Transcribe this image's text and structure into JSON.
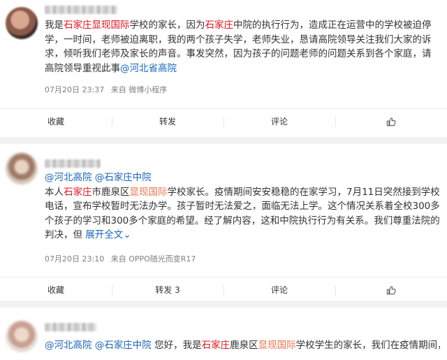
{
  "posts": [
    {
      "segments": [
        {
          "t": "我是",
          "c": ""
        },
        {
          "t": "石家庄",
          "c": "tag"
        },
        {
          "t": "显现国际",
          "c": "tag"
        },
        {
          "t": "学校的家长，因为",
          "c": ""
        },
        {
          "t": "石家庄",
          "c": "tag"
        },
        {
          "t": "中院的执行行为，造成正在运营中的学校被迫停学，一时间，老师被迫离职，我的两个孩子失学，老师失业，恳请高院领导关注我们大家的诉求，倾听我们老师及家长的声音。事发突然，因为孩子的问题老师的问题关系到各个家庭，请高院领导重视此事",
          "c": ""
        },
        {
          "t": "@河北省高院",
          "c": "mention"
        }
      ],
      "time": "07月20日 23:37",
      "source": "来自 微博小程序",
      "actions": {
        "fav": "收藏",
        "repost": "转发",
        "comment": "评论"
      }
    },
    {
      "segments": [
        {
          "t": "@河北高院",
          "c": "mention"
        },
        {
          "t": " ",
          "c": ""
        },
        {
          "t": "@石家庄中院",
          "c": "mention"
        },
        {
          "t": "\n本人",
          "c": ""
        },
        {
          "t": "石家庄",
          "c": "tag"
        },
        {
          "t": "市鹿泉区",
          "c": ""
        },
        {
          "t": "显现国际",
          "c": "link"
        },
        {
          "t": "学校家长。疫情期间安安稳稳的在家学习，7月11日突然接到学校电话，宣布学校暂时无法办学。孩子暂时无法爱之，面临无法上学。这个情况关系着全校300多个孩子的学习和300多个家庭的希望。经了解内容，这和中院执行行为有关系。我们尊重法院的判决，但 ",
          "c": ""
        },
        {
          "t": "展开全文",
          "c": "mention"
        },
        {
          "t": "⌄",
          "c": "mention"
        }
      ],
      "time": "07月20日 23:10",
      "source": "来自 OPPO随光而变R17",
      "actions": {
        "fav": "收藏",
        "repost": "转发 3",
        "comment": "评论"
      }
    },
    {
      "segments": [
        {
          "t": "@河北高院",
          "c": "mention"
        },
        {
          "t": " ",
          "c": ""
        },
        {
          "t": "@石家庄中院",
          "c": "mention"
        },
        {
          "t": " 您好，我是",
          "c": ""
        },
        {
          "t": "石家庄",
          "c": "tag"
        },
        {
          "t": "鹿泉区",
          "c": ""
        },
        {
          "t": "显现国际",
          "c": "link"
        },
        {
          "t": "学校学生的家长，我们在疫情期间，遵",
          "c": ""
        }
      ]
    }
  ]
}
